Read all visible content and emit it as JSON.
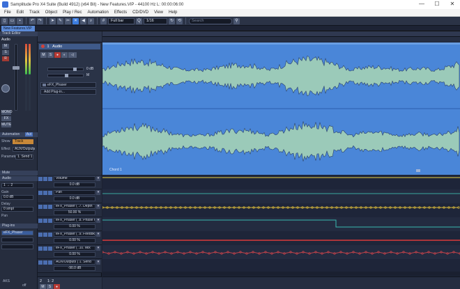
{
  "window": {
    "title": "Samplitude Pro X4 Suite (Build 4912) (x64 Bit)   -   New Features.VIP   -   44100 Hz L: 00:00:06:00",
    "controls": [
      "—",
      "☐",
      "✕"
    ]
  },
  "menu": [
    "File",
    "Edit",
    "Track",
    "Object",
    "Play / Rec",
    "Automation",
    "Effects",
    "CD/DVD",
    "View",
    "Help"
  ],
  "toolbar": {
    "grid_label": "Full bar",
    "quantize_label": "1/16",
    "search_placeholder": "Search"
  },
  "document_tab": "New Features.VIP",
  "left_panel": {
    "track_editor_header": "Track Editor",
    "track_name": "Audio",
    "buttons": [
      "M",
      "S",
      "R"
    ],
    "mono_label": "MONO",
    "fx_label": "FX",
    "mute_label": "MUTE",
    "automation_tab": "Automation",
    "automation_tab2": "Aut",
    "show_label": "Show",
    "show_value": "Track",
    "effect_label": "Effect",
    "effect_value": "AUX/Outputs",
    "parameter_label": "Parameter",
    "parameter_value": "1. Send 1",
    "mute_section": "Mute",
    "audio_section": "Audio",
    "channels_value": "1 → 2",
    "gain_label": "Gain",
    "gain_value": "0.0 dB",
    "delay_label": "Delay",
    "delay_value": "0 smpl",
    "pan_label": "Pan",
    "plugins_section": "Plug-ins",
    "plugin_item": "eFX_Phaser",
    "bottom_value": "AKS",
    "bottom_val2": "off"
  },
  "track": {
    "number": "1",
    "name": "Audio",
    "volume_value": "0 dB",
    "pan_value": "M",
    "plugin": "eFX_Phaser",
    "add_plugin": "Add Plug-in...",
    "automation_lanes": [
      {
        "name": "Volume",
        "value": "0.0 dB"
      },
      {
        "name": "Pan",
        "value": "0.0 dB"
      },
      {
        "name": "eFX_Phaser ( .7. Depth",
        "value": "50.00 %"
      },
      {
        "name": "eFX_Phaser ( .8. Phase O",
        "value": "0.00 %"
      },
      {
        "name": "eFX_Phaser ( .9. Feedbk",
        "value": "0.00 %"
      },
      {
        "name": "eFX_Phaser ( .10. Mix",
        "value": "0.00 %"
      },
      {
        "name": "AUX/Outputs ( 1. Send",
        "value": "-90.0 dB"
      }
    ],
    "second_track_number": "2",
    "second_track_name": "1: 2"
  },
  "arrange": {
    "clip_name": "Chord 1",
    "colors": {
      "wave_bg": "#4a86d8",
      "volume_line": "#e8d24a",
      "depth_line": "#d8b83a",
      "phase_line": "#3ab8b0",
      "feedback_line": "#d83a3a",
      "mix_line": "#9a2a3a"
    }
  }
}
